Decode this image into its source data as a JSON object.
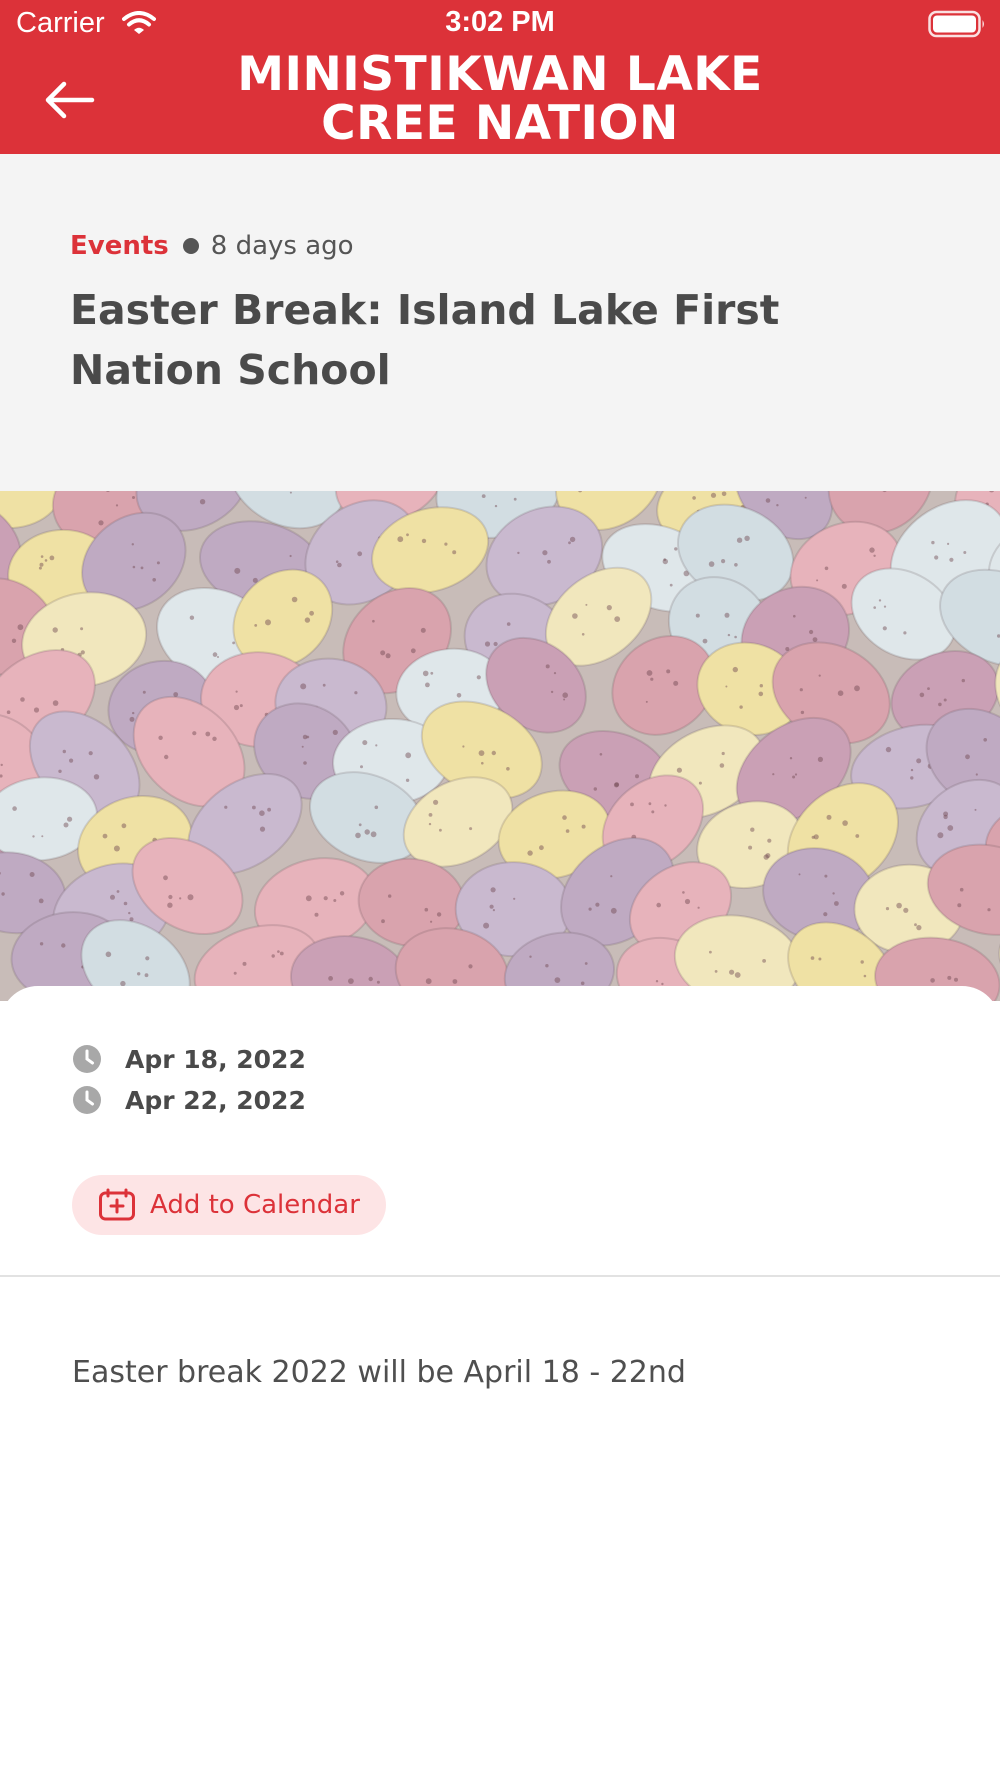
{
  "status_bar": {
    "carrier": "Carrier",
    "time": "3:02 PM"
  },
  "header": {
    "brand_line1": "MINISTIKWAN LAKE",
    "brand_line2": "CREE NATION",
    "back_icon": "arrow-left-icon",
    "color": "#dc3239"
  },
  "post": {
    "category": "Events",
    "posted": "8 days ago",
    "title": "Easter Break: Island Lake First Nation School",
    "image_subject": "pastel speckled easter eggs"
  },
  "event": {
    "start_date": "Apr 18, 2022",
    "end_date": "Apr 22, 2022",
    "date_icon": "clock-icon",
    "calendar_button_label": "Add to Calendar",
    "calendar_icon": "calendar-add-icon"
  },
  "description": "Easter break 2022 will be April 18 - 22nd"
}
